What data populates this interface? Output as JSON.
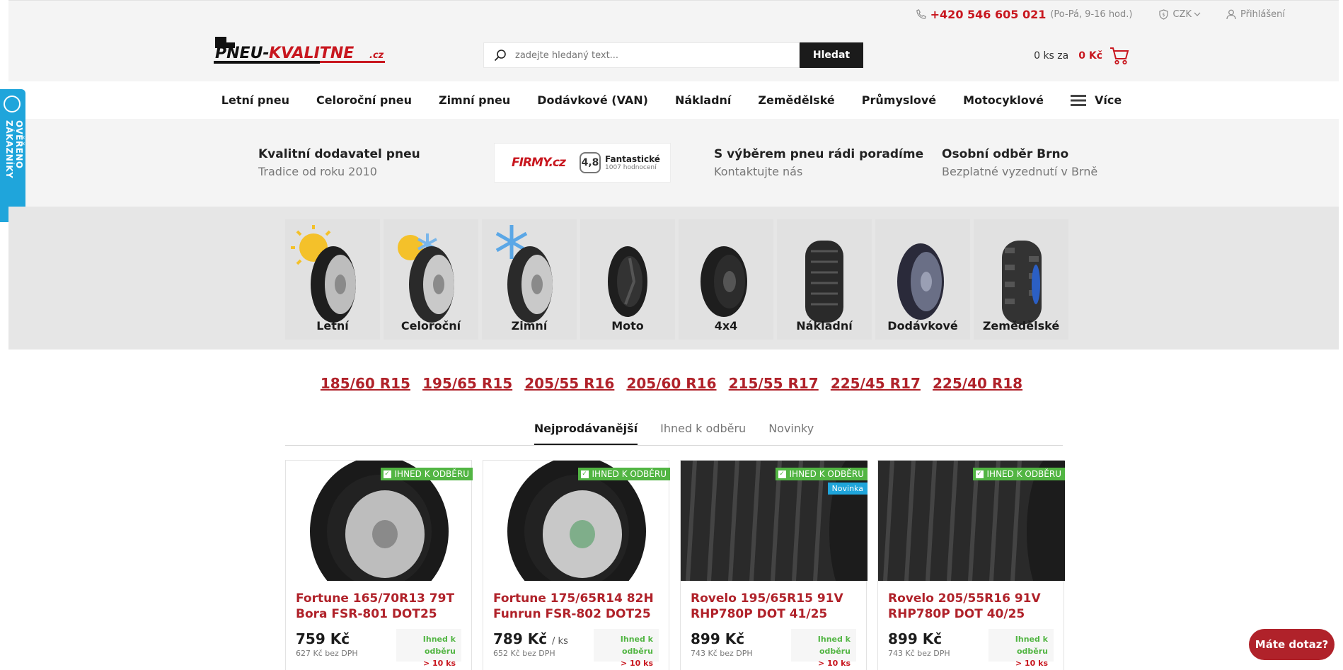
{
  "topbar": {
    "phone": "+420 546 605 021",
    "hours": "(Po-Pá, 9-16 hod.)",
    "currency": "CZK",
    "login": "Přihlášení"
  },
  "logo": {
    "text_main": "PNEU-",
    "text_accent": "KVALITNE",
    "text_tld": ".cz"
  },
  "search": {
    "placeholder": "zadejte hledaný text...",
    "button": "Hledat"
  },
  "cart": {
    "qty": "0 ks za",
    "amount": "0 Kč"
  },
  "nav": {
    "items": [
      "Letní pneu",
      "Celoroční pneu",
      "Zimní pneu",
      "Dodávkové (VAN)",
      "Nákladní",
      "Zemědělské",
      "Průmyslové",
      "Motocyklové"
    ],
    "more": "Více"
  },
  "usp": {
    "items": [
      {
        "title": "Kvalitní dodavatel pneu",
        "sub": "Tradice od roku 2010"
      },
      {
        "title": "S výběrem pneu rádi poradíme",
        "sub": "Kontaktujte nás"
      },
      {
        "title": "Osobní odběr Brno",
        "sub": "Bezplatné vyzednutí v Brně"
      }
    ],
    "firmy": {
      "logo": "FIRMY.cz",
      "score": "4,8",
      "label": "Fantastické",
      "count": "1007 hodnocení"
    }
  },
  "side_badge": "OVĚŘENO ZÁKAZNÍKY",
  "categories": [
    "Letní",
    "Celoroční",
    "Zimní",
    "Moto",
    "4x4",
    "Nákladní",
    "Dodávkové",
    "Zemědělské"
  ],
  "sizes": [
    "185/60 R15",
    "195/65 R15",
    "205/55 R16",
    "205/60 R16",
    "215/55 R17",
    "225/45 R17",
    "225/40 R18"
  ],
  "tabs": [
    "Nejprodávanější",
    "Ihned k odběru",
    "Novinky"
  ],
  "stock_label": "IHNED K ODBĚRU",
  "new_label": "Novinka",
  "products": [
    {
      "name": "Fortune 165/70R13 79T Bora FSR-801 DOT25",
      "price": "759 Kč",
      "per": "",
      "net": "627 Kč bez DPH",
      "avail": "Ihned k odběru",
      "count": "> 10 ks"
    },
    {
      "name": "Fortune 175/65R14 82H Funrun FSR-802 DOT25",
      "price": "789 Kč",
      "per": "/ ks",
      "net": "652 Kč bez DPH",
      "avail": "Ihned k odběru",
      "count": "> 10 ks"
    },
    {
      "name": "Rovelo 195/65R15 91V RHP780P DOT 41/25",
      "price": "899 Kč",
      "per": "",
      "net": "743 Kč bez DPH",
      "avail": "Ihned k odběru",
      "count": "> 10 ks"
    },
    {
      "name": "Rovelo 205/55R16 91V RHP780P DOT 40/25",
      "price": "899 Kč",
      "per": "",
      "net": "743 Kč bez DPH",
      "avail": "Ihned k odběru",
      "count": "> 10 ks"
    }
  ],
  "chat": "Máte dotaz?",
  "colors": {
    "brand": "#c8171f",
    "link": "#b0222a",
    "stock": "#52b543",
    "badge": "#1fa5db"
  }
}
